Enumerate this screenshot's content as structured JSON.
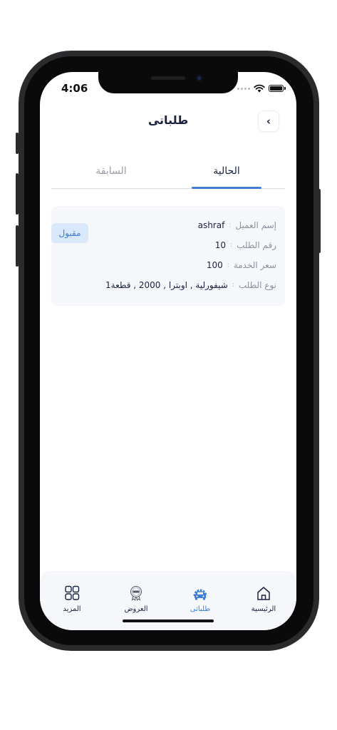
{
  "status_bar": {
    "time": "4:06"
  },
  "header": {
    "title": "طلباتى",
    "back_glyph": "‹"
  },
  "tabs": [
    {
      "label": "الحالية",
      "active": true
    },
    {
      "label": "السابقة",
      "active": false
    }
  ],
  "order": {
    "status": "مقبول",
    "separator": ":",
    "rows": [
      {
        "label": "إسم العميل",
        "value": "ashraf"
      },
      {
        "label": "رقم الطلب",
        "value": "10"
      },
      {
        "label": "سعر الخدمة",
        "value": "100"
      },
      {
        "label": "نوع الطلب",
        "value": "شيفورلية , اوبترا , 2000 , قطعة1"
      }
    ]
  },
  "bottom_nav": [
    {
      "label": "الرئيسية",
      "icon": "home-icon",
      "active": false
    },
    {
      "label": "طلباتى",
      "icon": "car-service-icon",
      "active": true
    },
    {
      "label": "العروض",
      "icon": "brand-offer-icon",
      "active": false
    },
    {
      "label": "المزيد",
      "icon": "grid-icon",
      "active": false
    }
  ],
  "colors": {
    "accent": "#3f7ed8",
    "text": "#1b2240",
    "card": "#f5f7fa",
    "badge": "#d9e8fa"
  }
}
